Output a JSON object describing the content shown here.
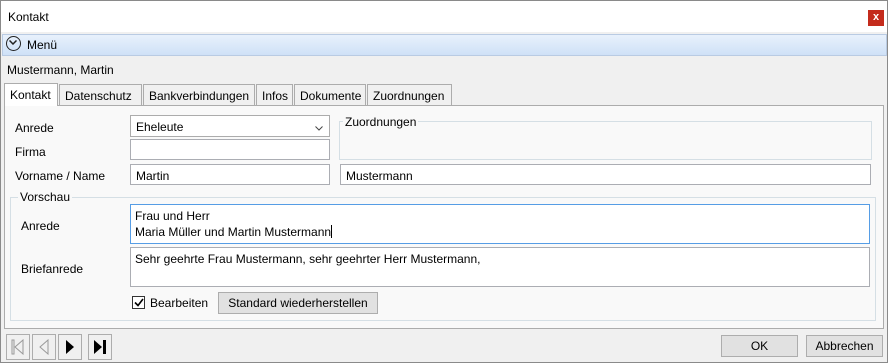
{
  "window": {
    "title": "Kontakt",
    "close_label": "x"
  },
  "menu": {
    "label": "Menü",
    "icon": "chevron-down-circle-icon"
  },
  "contact_name": "Mustermann, Martin",
  "tabs": [
    "Kontakt",
    "Datenschutz",
    "Bankverbindungen",
    "Infos",
    "Dokumente",
    "Zuordnungen"
  ],
  "active_tab": "Kontakt",
  "form": {
    "anrede_label": "Anrede",
    "anrede_value": "Eheleute",
    "firma_label": "Firma",
    "firma_value": "",
    "name_label": "Vorname / Name",
    "vorname_value": "Martin",
    "nachname_value": "Mustermann",
    "zuordnungen_title": "Zuordnungen"
  },
  "vorschau": {
    "title": "Vorschau",
    "anrede_label": "Anrede",
    "anrede_line1": "Frau und Herr",
    "anrede_line2": "Maria Müller und Martin Mustermann",
    "briefanrede_label": "Briefanrede",
    "briefanrede_value": "Sehr geehrte Frau Mustermann, sehr geehrter Herr Mustermann,",
    "bearbeiten_label": "Bearbeiten",
    "bearbeiten_checked": true,
    "reset_label": "Standard wiederherstellen"
  },
  "footer": {
    "ok_label": "OK",
    "cancel_label": "Abbrechen"
  },
  "colors": {
    "close": "#c42b1c",
    "menubar": "#cfe1f7",
    "focus_border": "#569de5"
  }
}
